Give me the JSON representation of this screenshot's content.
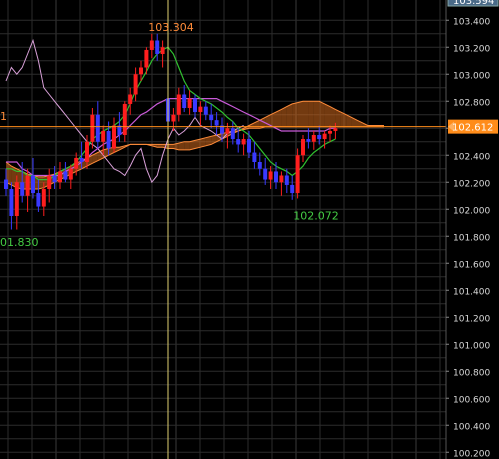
{
  "chart_data": {
    "type": "candlestick",
    "y_ticks": [
      "103.400",
      "103.200",
      "103.000",
      "102.800",
      "102.600",
      "102.400",
      "102.200",
      "102.000",
      "101.800",
      "101.600",
      "101.400",
      "101.200",
      "101.000",
      "100.800",
      "100.600",
      "100.400",
      "100.200"
    ],
    "ylim": [
      100.15,
      103.55
    ],
    "top_price_label": "103.594",
    "current_price": 102.612,
    "current_price_label": "102.612",
    "annotations": [
      {
        "text": "103.304",
        "value": 103.304,
        "color": "#ff8c3a"
      },
      {
        "text": "102.072",
        "value": 102.072,
        "color": "#44cc44"
      },
      {
        "text": "01.830",
        "value": 101.83,
        "color": "#44cc44"
      },
      {
        "text": "1",
        "value": 102.69,
        "color": "#ff8c3a"
      }
    ],
    "crosshair_index": 30,
    "candles": [
      [
        102.22,
        102.3,
        102.1,
        102.15
      ],
      [
        102.15,
        102.2,
        101.85,
        101.95
      ],
      [
        101.95,
        102.25,
        101.85,
        102.2
      ],
      [
        102.2,
        102.35,
        102.05,
        102.1
      ],
      [
        102.1,
        102.3,
        101.98,
        102.25
      ],
      [
        102.25,
        102.38,
        102.08,
        102.12
      ],
      [
        102.12,
        102.22,
        101.98,
        102.02
      ],
      [
        102.02,
        102.2,
        101.95,
        102.15
      ],
      [
        102.15,
        102.3,
        102.05,
        102.25
      ],
      [
        102.25,
        102.32,
        102.15,
        102.2
      ],
      [
        102.2,
        102.35,
        102.15,
        102.28
      ],
      [
        102.28,
        102.35,
        102.2,
        102.22
      ],
      [
        102.22,
        102.33,
        102.15,
        102.3
      ],
      [
        102.3,
        102.42,
        102.25,
        102.38
      ],
      [
        102.38,
        102.5,
        102.3,
        102.35
      ],
      [
        102.35,
        102.55,
        102.3,
        102.5
      ],
      [
        102.5,
        102.75,
        102.45,
        102.7
      ],
      [
        102.7,
        102.8,
        102.45,
        102.5
      ],
      [
        102.5,
        102.62,
        102.4,
        102.58
      ],
      [
        102.58,
        102.65,
        102.4,
        102.45
      ],
      [
        102.45,
        102.68,
        102.42,
        102.62
      ],
      [
        102.62,
        102.72,
        102.5,
        102.55
      ],
      [
        102.55,
        102.8,
        102.5,
        102.78
      ],
      [
        102.78,
        102.9,
        102.7,
        102.85
      ],
      [
        102.85,
        103.05,
        102.8,
        103.0
      ],
      [
        103.0,
        103.1,
        102.95,
        103.05
      ],
      [
        103.05,
        103.2,
        103.0,
        103.18
      ],
      [
        103.18,
        103.3,
        103.12,
        103.25
      ],
      [
        103.25,
        103.3,
        103.1,
        103.15
      ],
      [
        103.15,
        103.25,
        103.05,
        103.2
      ],
      [
        102.82,
        102.85,
        102.6,
        102.65
      ],
      [
        102.65,
        102.75,
        102.58,
        102.7
      ],
      [
        102.7,
        102.9,
        102.65,
        102.85
      ],
      [
        102.85,
        102.92,
        102.72,
        102.75
      ],
      [
        102.75,
        102.88,
        102.7,
        102.82
      ],
      [
        102.82,
        102.85,
        102.68,
        102.72
      ],
      [
        102.72,
        102.8,
        102.62,
        102.76
      ],
      [
        102.76,
        102.8,
        102.66,
        102.7
      ],
      [
        102.7,
        102.78,
        102.6,
        102.66
      ],
      [
        102.66,
        102.72,
        102.55,
        102.62
      ],
      [
        102.62,
        102.68,
        102.5,
        102.56
      ],
      [
        102.56,
        102.64,
        102.45,
        102.6
      ],
      [
        102.6,
        102.65,
        102.48,
        102.52
      ],
      [
        102.52,
        102.6,
        102.42,
        102.48
      ],
      [
        102.48,
        102.56,
        102.4,
        102.52
      ],
      [
        102.52,
        102.58,
        102.38,
        102.42
      ],
      [
        102.42,
        102.5,
        102.3,
        102.35
      ],
      [
        102.35,
        102.42,
        102.25,
        102.3
      ],
      [
        102.3,
        102.38,
        102.18,
        102.22
      ],
      [
        102.22,
        102.32,
        102.15,
        102.28
      ],
      [
        102.28,
        102.35,
        102.15,
        102.2
      ],
      [
        102.2,
        102.28,
        102.1,
        102.25
      ],
      [
        102.25,
        102.3,
        102.12,
        102.18
      ],
      [
        102.18,
        102.25,
        102.07,
        102.12
      ],
      [
        102.12,
        102.45,
        102.08,
        102.4
      ],
      [
        102.4,
        102.55,
        102.35,
        102.52
      ],
      [
        102.52,
        102.6,
        102.45,
        102.5
      ],
      [
        102.5,
        102.58,
        102.44,
        102.55
      ],
      [
        102.55,
        102.62,
        102.48,
        102.52
      ],
      [
        102.52,
        102.58,
        102.45,
        102.56
      ],
      [
        102.56,
        102.62,
        102.5,
        102.58
      ],
      [
        102.58,
        102.64,
        102.52,
        102.6
      ]
    ],
    "tenkan": [
      102.3,
      102.3,
      102.28,
      102.28,
      102.25,
      102.25,
      102.22,
      102.22,
      102.22,
      102.25,
      102.28,
      102.3,
      102.32,
      102.35,
      102.4,
      102.45,
      102.52,
      102.55,
      102.58,
      102.6,
      102.62,
      102.65,
      102.7,
      102.78,
      102.88,
      102.95,
      103.02,
      103.1,
      103.15,
      103.18,
      103.2,
      103.15,
      103.05,
      102.95,
      102.88,
      102.85,
      102.82,
      102.8,
      102.78,
      102.75,
      102.72,
      102.68,
      102.65,
      102.6,
      102.58,
      102.55,
      102.5,
      102.45,
      102.4,
      102.35,
      102.32,
      102.3,
      102.28,
      102.25,
      102.28,
      102.32,
      102.38,
      102.42,
      102.45,
      102.48,
      102.5,
      102.52
    ],
    "kijun": [
      102.35,
      102.35,
      102.35,
      102.3,
      102.28,
      102.25,
      102.25,
      102.25,
      102.25,
      102.25,
      102.25,
      102.28,
      102.3,
      102.32,
      102.35,
      102.38,
      102.42,
      102.45,
      102.48,
      102.5,
      102.52,
      102.55,
      102.58,
      102.62,
      102.66,
      102.7,
      102.72,
      102.75,
      102.78,
      102.8,
      102.82,
      102.82,
      102.82,
      102.82,
      102.82,
      102.82,
      102.82,
      102.82,
      102.82,
      102.82,
      102.8,
      102.78,
      102.76,
      102.74,
      102.72,
      102.7,
      102.68,
      102.66,
      102.64,
      102.62,
      102.6,
      102.58,
      102.58,
      102.58,
      102.58,
      102.58,
      102.58,
      102.58,
      102.58,
      102.58,
      102.6,
      102.6
    ],
    "chikou": [
      102.95,
      103.05,
      103.0,
      103.05,
      103.15,
      103.25,
      103.1,
      102.9,
      102.85,
      102.8,
      102.75,
      102.7,
      102.65,
      102.6,
      102.55,
      102.5,
      102.48,
      102.45,
      102.4,
      102.35,
      102.3,
      102.28,
      102.25,
      102.32,
      102.4,
      102.45,
      102.3,
      102.2,
      102.25,
      102.4,
      102.52,
      102.6,
      102.55,
      102.58,
      102.62,
      102.68,
      102.62,
      102.6,
      102.58,
      102.55,
      102.52,
      102.56,
      102.58,
      102.6,
      102.62
    ],
    "span_a": [
      102.35,
      102.32,
      102.3,
      102.28,
      102.26,
      102.25,
      102.24,
      102.24,
      102.25,
      102.26,
      102.28,
      102.3,
      102.32,
      102.34,
      102.36,
      102.38,
      102.4,
      102.42,
      102.44,
      102.45,
      102.46,
      102.46,
      102.47,
      102.48,
      102.48,
      102.48,
      102.48,
      102.47,
      102.46,
      102.46,
      102.45,
      102.45,
      102.44,
      102.44,
      102.44,
      102.45,
      102.46,
      102.47,
      102.48,
      102.5,
      102.52,
      102.54,
      102.56,
      102.58,
      102.6,
      102.62,
      102.64,
      102.66,
      102.68,
      102.7,
      102.72,
      102.74,
      102.76,
      102.78,
      102.79,
      102.8,
      102.8,
      102.8,
      102.8,
      102.78,
      102.76,
      102.74,
      102.72,
      102.7,
      102.68,
      102.66,
      102.64,
      102.62,
      102.62,
      102.62,
      102.62
    ],
    "span_b": [
      102.2,
      102.18,
      102.16,
      102.15,
      102.15,
      102.15,
      102.15,
      102.16,
      102.18,
      102.2,
      102.22,
      102.24,
      102.26,
      102.28,
      102.3,
      102.32,
      102.34,
      102.36,
      102.38,
      102.4,
      102.42,
      102.44,
      102.46,
      102.48,
      102.48,
      102.48,
      102.48,
      102.48,
      102.48,
      102.48,
      102.48,
      102.48,
      102.49,
      102.5,
      102.5,
      102.51,
      102.52,
      102.53,
      102.54,
      102.55,
      102.56,
      102.57,
      102.58,
      102.58,
      102.59,
      102.6,
      102.6,
      102.6,
      102.61,
      102.61,
      102.61,
      102.61,
      102.61,
      102.61,
      102.61,
      102.61,
      102.61,
      102.61,
      102.61,
      102.61,
      102.61,
      102.61,
      102.61,
      102.61,
      102.61,
      102.61,
      102.61,
      102.61,
      102.61,
      102.61,
      102.61
    ],
    "colors": {
      "background": "#000000",
      "grid": "#2c2c2c",
      "up": "#ff1e1e",
      "down": "#3a3aff",
      "tenkan": "#c85ad8",
      "kijun": "#30c030",
      "chikou": "#d8a0d8",
      "cloud_fill": "#d2691e",
      "cloud_edge": "#ff8c3a",
      "price_line": "#ff8c1a",
      "crosshair": "#e0d070",
      "axis_text": "#d8d8d8"
    }
  }
}
